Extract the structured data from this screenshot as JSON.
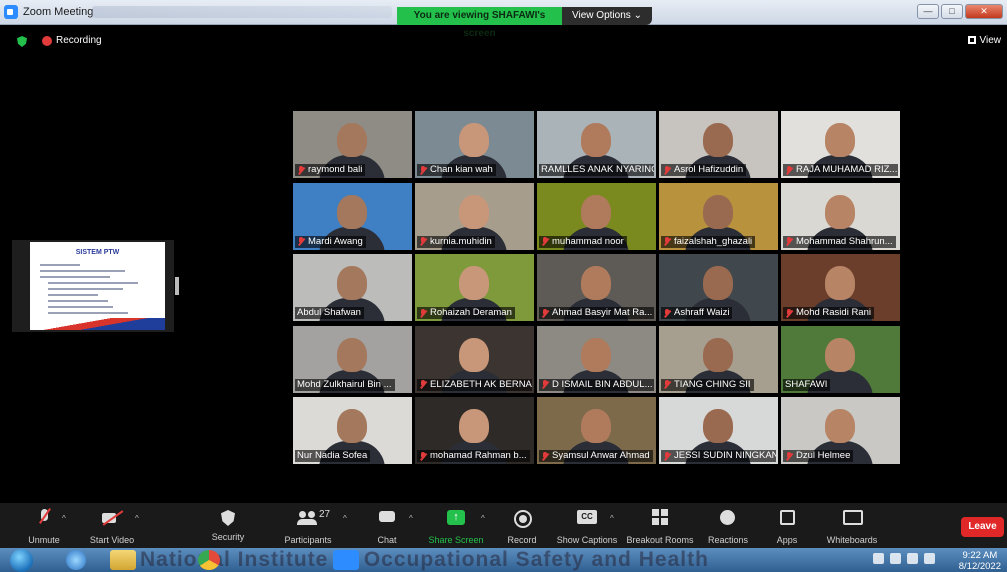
{
  "window": {
    "title": "Zoom Meeting",
    "share_banner": "You are viewing SHAFAWI's screen",
    "view_options": "View Options",
    "minimize": "—",
    "maximize": "□",
    "close": "✕"
  },
  "meeting_bar": {
    "recording_label": "Recording",
    "view_label": "View"
  },
  "shared_slide": {
    "title": "SISTEM PTW"
  },
  "participants": [
    {
      "name": "raymond bali",
      "muted": true
    },
    {
      "name": "Chan kian wah",
      "muted": true
    },
    {
      "name": "RAMLLES ANAK NYARING",
      "muted": false
    },
    {
      "name": "Asrol Hafizuddin",
      "muted": true
    },
    {
      "name": "RAJA MUHAMAD RIZ...",
      "muted": true
    },
    {
      "name": "Mardi Awang",
      "muted": true
    },
    {
      "name": "kurnia.muhidin",
      "muted": true
    },
    {
      "name": "muhammad noor",
      "muted": true
    },
    {
      "name": "faizalshah_ghazali",
      "muted": true
    },
    {
      "name": "Mohammad Shahrun...",
      "muted": true
    },
    {
      "name": "Abdul Shafwan",
      "muted": false
    },
    {
      "name": "Rohaizah Deraman",
      "muted": true
    },
    {
      "name": "Ahmad Basyir Mat Ra...",
      "muted": true
    },
    {
      "name": "Ashraff Waizi",
      "muted": true
    },
    {
      "name": "Mohd Rasidi Rani",
      "muted": true
    },
    {
      "name": "Mohd Zulkhairul Bin ...",
      "muted": false
    },
    {
      "name": "ELIZABETH AK BERNA...",
      "muted": true
    },
    {
      "name": "D ISMAIL BIN ABDUL...",
      "muted": true
    },
    {
      "name": "TIANG CHING SII",
      "muted": true
    },
    {
      "name": "SHAFAWI",
      "muted": false,
      "speaking": true
    },
    {
      "name": "Nur Nadia Sofea",
      "muted": false
    },
    {
      "name": "mohamad Rahman b...",
      "muted": true
    },
    {
      "name": "Syamsul Anwar Ahmad",
      "muted": true
    },
    {
      "name": "JESSI SUDIN NINGKAN",
      "muted": true
    },
    {
      "name": "Dzul Helmee",
      "muted": true
    }
  ],
  "toolbar": {
    "unmute": "Unmute",
    "start_video": "Start Video",
    "security": "Security",
    "participants": "Participants",
    "participants_count": "27",
    "chat": "Chat",
    "share_screen": "Share Screen",
    "record": "Record",
    "show_captions": "Show Captions",
    "breakout_rooms": "Breakout Rooms",
    "reactions": "Reactions",
    "apps": "Apps",
    "whiteboards": "Whiteboards",
    "leave": "Leave"
  },
  "taskbar": {
    "overlay_text": "National Institute of Occupational Safety and Health",
    "time": "9:22 AM",
    "date": "8/12/2022"
  },
  "colors": {
    "accent_green": "#23c04c",
    "leave_red": "#e02828",
    "speaker_highlight": "#e6e21d"
  }
}
